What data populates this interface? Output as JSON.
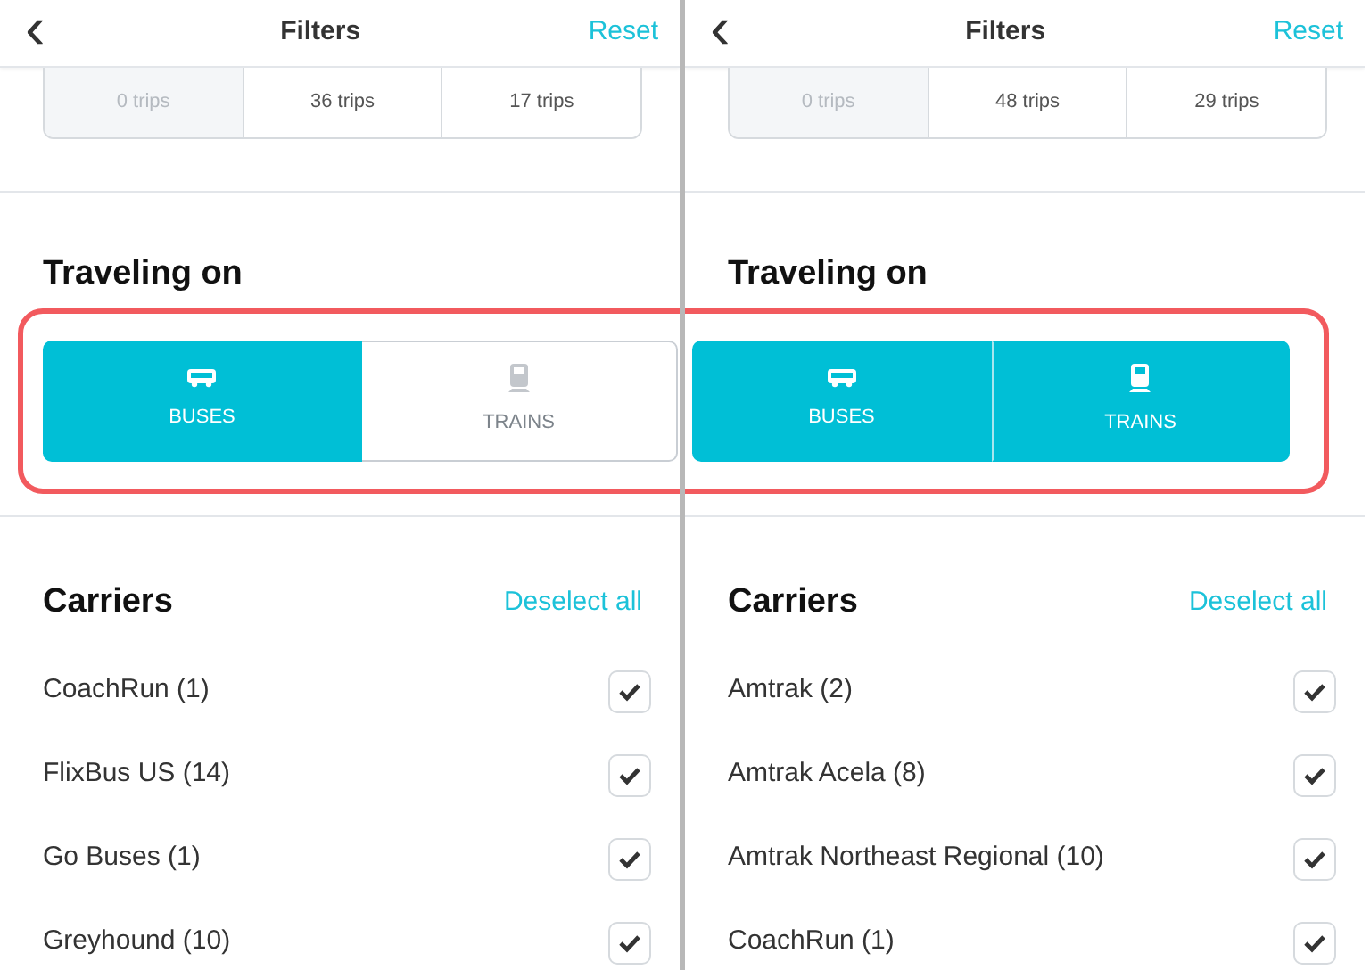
{
  "panels": [
    {
      "header": {
        "back": "‹",
        "title": "Filters",
        "action": "Reset"
      },
      "trip_counts": [
        {
          "label": "0 trips",
          "disabled": true
        },
        {
          "label": "36 trips",
          "disabled": false
        },
        {
          "label": "17 trips",
          "disabled": false
        }
      ],
      "traveling_on": {
        "title": "Traveling on",
        "highlighted": true,
        "options": [
          {
            "kind": "bus",
            "label": "BUSES",
            "selected": true
          },
          {
            "kind": "train",
            "label": "TRAINS",
            "selected": false
          }
        ]
      },
      "carriers": {
        "title": "Carriers",
        "action": "Deselect all",
        "items": [
          {
            "label": "CoachRun (1)",
            "checked": true
          },
          {
            "label": "FlixBus US (14)",
            "checked": true
          },
          {
            "label": "Go Buses (1)",
            "checked": true
          },
          {
            "label": "Greyhound (10)",
            "checked": true
          }
        ]
      }
    },
    {
      "header": {
        "back": "‹",
        "title": "Filters",
        "action": "Reset"
      },
      "trip_counts": [
        {
          "label": "0 trips",
          "disabled": true
        },
        {
          "label": "48 trips",
          "disabled": false
        },
        {
          "label": "29 trips",
          "disabled": false
        }
      ],
      "traveling_on": {
        "title": "Traveling on",
        "highlighted": true,
        "options": [
          {
            "kind": "bus",
            "label": "BUSES",
            "selected": true
          },
          {
            "kind": "train",
            "label": "TRAINS",
            "selected": true
          }
        ]
      },
      "carriers": {
        "title": "Carriers",
        "action": "Deselect all",
        "items": [
          {
            "label": "Amtrak (2)",
            "checked": true
          },
          {
            "label": "Amtrak Acela (8)",
            "checked": true
          },
          {
            "label": "Amtrak Northeast Regional (10)",
            "checked": true
          },
          {
            "label": "CoachRun (1)",
            "checked": true
          }
        ]
      }
    }
  ]
}
